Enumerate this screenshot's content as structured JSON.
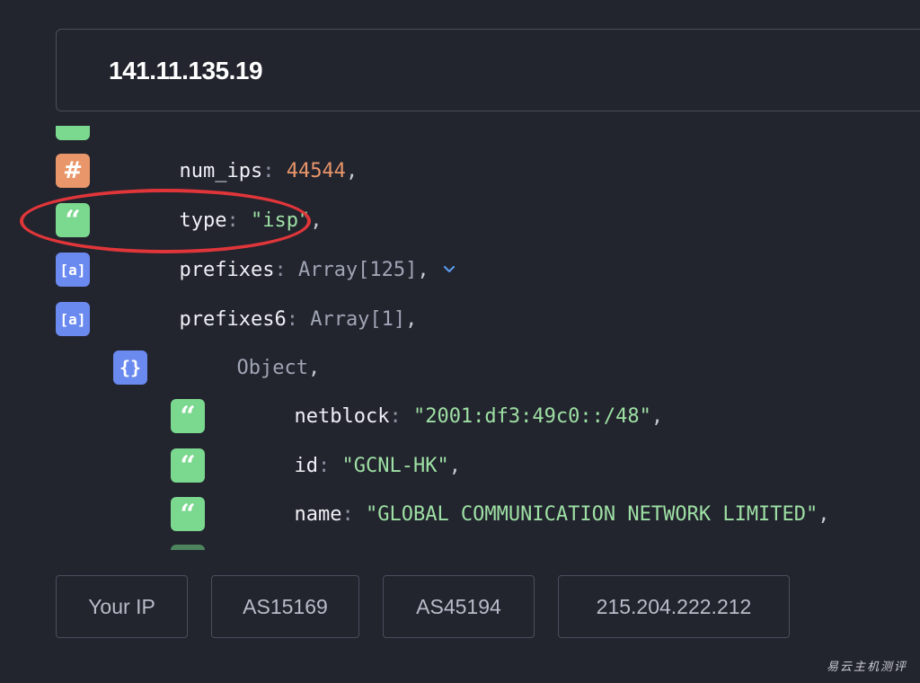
{
  "search": {
    "value": "141.11.135.19"
  },
  "json_rows": [
    {
      "type": "num",
      "badge": "#",
      "key": "num_ips",
      "value": "44544"
    },
    {
      "type": "str",
      "badge": "“",
      "key": "type",
      "value": "\"isp\""
    },
    {
      "type": "arr",
      "badge": "[a]",
      "key": "prefixes",
      "value": "Array[125]",
      "expandable": true,
      "chevron_icon": "chevron-down-icon"
    },
    {
      "type": "arr",
      "badge": "[a]",
      "key": "prefixes6",
      "value": "Array[1]"
    },
    {
      "type": "obj",
      "badge": "{}",
      "label": "Object"
    },
    {
      "type": "str",
      "badge": "“",
      "key": "netblock",
      "value": "\"2001:df3:49c0::/48\""
    },
    {
      "type": "str",
      "badge": "“",
      "key": "id",
      "value": "\"GCNL-HK\""
    },
    {
      "type": "str",
      "badge": "“",
      "key": "name",
      "value": "\"GLOBAL COMMUNICATION NETWORK LIMITED\""
    }
  ],
  "quick_links": [
    "Your IP",
    "AS15169",
    "AS45194",
    "215.204.222.212"
  ],
  "watermark": "易云主机测评",
  "colors": {
    "background": "#22242e",
    "number": "#e9966a",
    "string": "#7bd88f",
    "array": "#6b8af0",
    "highlight": "#e0363a"
  }
}
